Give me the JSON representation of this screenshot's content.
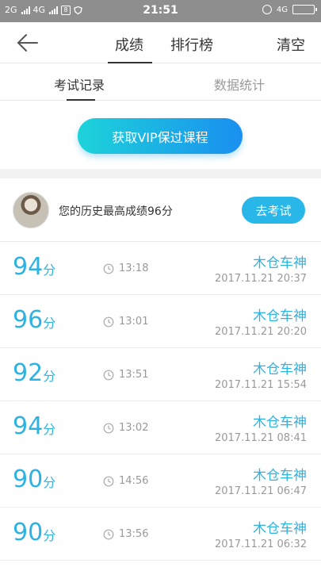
{
  "status": {
    "network_left": "2G",
    "network_mid": "4G",
    "box_label": "8",
    "time": "21:51",
    "network_right": "4G"
  },
  "header": {
    "tabs": [
      {
        "label": "成绩"
      },
      {
        "label": "排行榜"
      }
    ],
    "clear_label": "清空"
  },
  "subtabs": [
    {
      "label": "考试记录"
    },
    {
      "label": "数据统计"
    }
  ],
  "vip": {
    "label": "获取VIP保过课程"
  },
  "best": {
    "text": "您的历史最高成绩96分",
    "exam_label": "去考试"
  },
  "records": [
    {
      "score": "94",
      "unit": "分",
      "duration": "13:18",
      "name": "木仓车神",
      "date": "2017.11.21  20:37"
    },
    {
      "score": "96",
      "unit": "分",
      "duration": "13:01",
      "name": "木仓车神",
      "date": "2017.11.21  20:20"
    },
    {
      "score": "92",
      "unit": "分",
      "duration": "13:51",
      "name": "木仓车神",
      "date": "2017.11.21  15:54"
    },
    {
      "score": "94",
      "unit": "分",
      "duration": "13:02",
      "name": "木仓车神",
      "date": "2017.11.21  08:41"
    },
    {
      "score": "90",
      "unit": "分",
      "duration": "14:56",
      "name": "木仓车神",
      "date": "2017.11.21  06:47"
    },
    {
      "score": "90",
      "unit": "分",
      "duration": "13:56",
      "name": "木仓车神",
      "date": "2017.11.21  06:32"
    }
  ],
  "colors": {
    "accent": "#2eb2e2",
    "vip_gradient_start": "#1dd3d9",
    "vip_gradient_end": "#1a8ff0"
  },
  "icons": {
    "back": "arrow-left-icon",
    "clock": "clock-icon"
  }
}
